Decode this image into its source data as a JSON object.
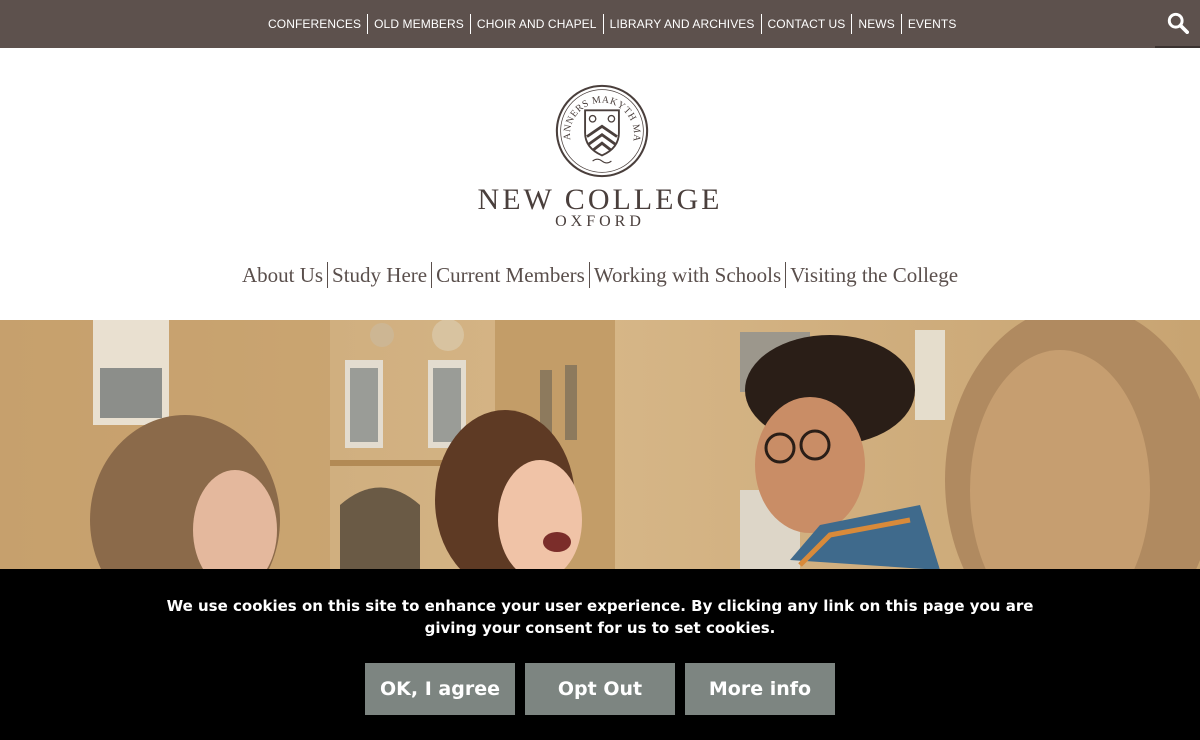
{
  "topnav": {
    "items": [
      {
        "label": "CONFERENCES"
      },
      {
        "label": "OLD MEMBERS"
      },
      {
        "label": "CHOIR AND CHAPEL"
      },
      {
        "label": "LIBRARY AND ARCHIVES"
      },
      {
        "label": "CONTACT US"
      },
      {
        "label": "NEWS"
      },
      {
        "label": "EVENTS"
      }
    ],
    "search_icon": "search-icon"
  },
  "logo": {
    "motto": "MANNERS MAKYTH MAN",
    "name": "NEW COLLEGE",
    "subname": "OXFORD"
  },
  "mainnav": {
    "items": [
      {
        "label": "About Us"
      },
      {
        "label": "Study Here"
      },
      {
        "label": "Current Members"
      },
      {
        "label": "Working with Schools"
      },
      {
        "label": "Visiting the College"
      }
    ]
  },
  "cookie": {
    "message": "We use cookies on this site to enhance your user experience. By clicking any link on this page you are giving your consent for us to set cookies.",
    "agree_label": "OK, I agree",
    "optout_label": "Opt Out",
    "moreinfo_label": "More info"
  },
  "colors": {
    "topbar": "#5d514d",
    "text_brown": "#4a3f3c",
    "button_grey": "#7d8581"
  }
}
